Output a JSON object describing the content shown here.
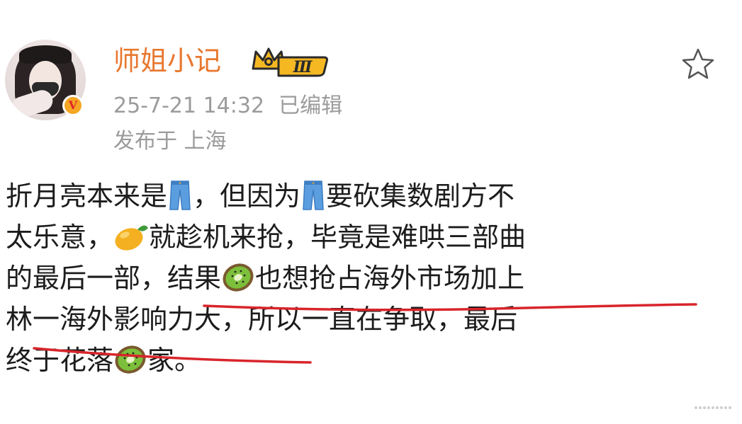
{
  "post": {
    "author": {
      "name": "师姐小记",
      "level_badge": "Ⅲ",
      "verified_badge": "V"
    },
    "meta": {
      "timestamp": "25-7-21 14:32",
      "edited_label": "已编辑",
      "location_label": "发布于 上海"
    },
    "body_lines": [
      [
        "折月亮本来是",
        "jeans-icon",
        "，但因为",
        "jeans-icon",
        "要砍集数剧方不"
      ],
      [
        "太乐意，",
        "mango-icon",
        "就趁机来抢，毕竟是难哄三部曲"
      ],
      [
        "的最后一部，结果",
        "kiwi-icon",
        "也想抢占海外市场加上"
      ],
      [
        "林一海外影响力大，所以一直在争取，最后"
      ],
      [
        "终于花落",
        "kiwi-icon",
        "家。"
      ]
    ],
    "text": {
      "l1a": "折月亮本来是",
      "l1b": "，但因为",
      "l1c": "要砍集数剧方不",
      "l2a": "太乐意，",
      "l2b": "就趁机来抢，毕竟是难哄三部曲",
      "l3a": "的最后一部，结果",
      "l3b": "也想抢占海外市场加上",
      "l4": "林一海外影响力大，所以一直在争取，最后",
      "l5a": "终于花落",
      "l5b": "家。"
    }
  },
  "icons": {
    "favorite": "star-outline-icon",
    "jeans": "jeans-icon",
    "mango": "mango-icon",
    "kiwi": "kiwi-icon"
  },
  "colors": {
    "username": "#e8772e",
    "meta_text": "#9b9b9b",
    "body_text": "#1c1c1c",
    "underline": "#d8252b",
    "badge_gold": "#f5b823"
  }
}
